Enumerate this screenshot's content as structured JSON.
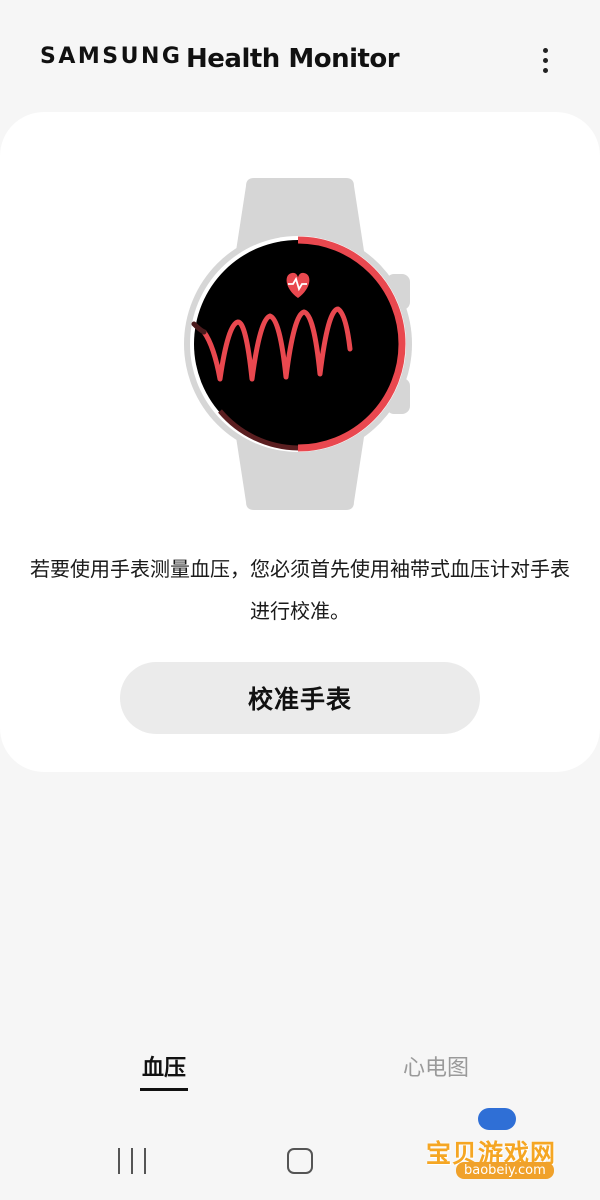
{
  "header": {
    "brand": "SAMSUNG",
    "title": "Health Monitor",
    "more_icon": "more-vertical-icon"
  },
  "card": {
    "illustration": "smartwatch-blood-pressure-illustration",
    "description": "若要使用手表测量血压，您必须首先使用袖带式血压计对手表进行校准。",
    "calibrate_button": "校准手表"
  },
  "tabs": [
    {
      "label": "血压",
      "active": true
    },
    {
      "label": "心电图",
      "active": false
    }
  ],
  "navbar": {
    "recents_icon": "recents-icon",
    "home_icon": "home-icon"
  },
  "watermark": {
    "text": "宝贝游戏网",
    "url": "baobeiy.com"
  },
  "colors": {
    "accent_red": "#e9484f",
    "background": "#f6f6f6",
    "card": "#ffffff",
    "button": "#ebebeb",
    "watermark_orange": "#f5a623"
  }
}
